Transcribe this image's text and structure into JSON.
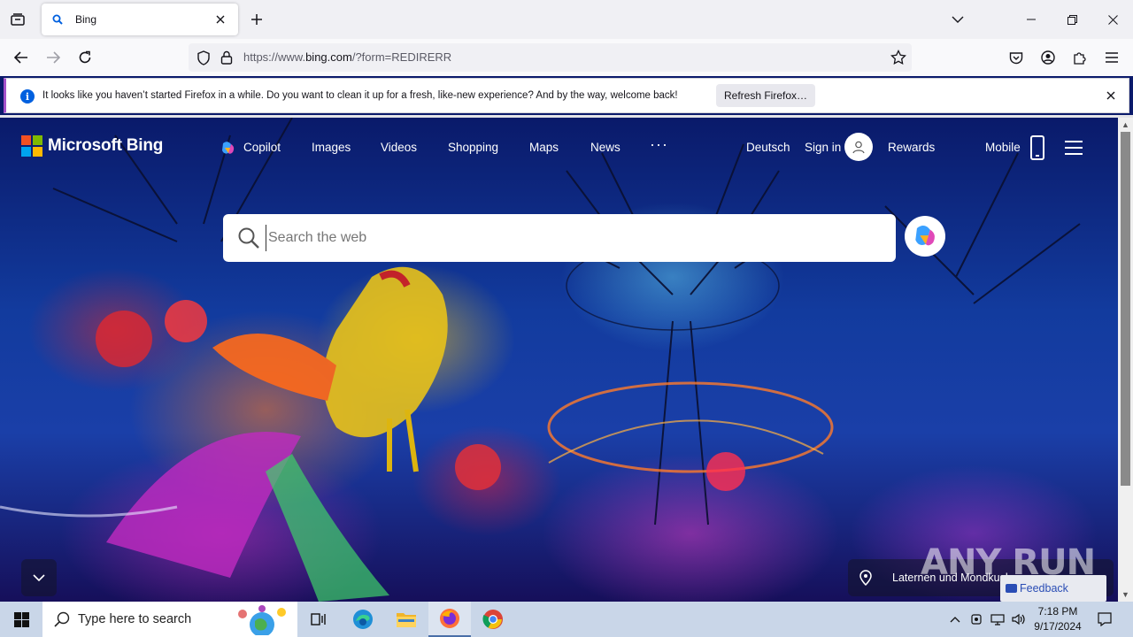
{
  "browser": {
    "tab_title": "Bing",
    "url_prefix": "https://www.",
    "url_domain": "bing.com",
    "url_path": "/?form=REDIRERR"
  },
  "notification": {
    "message": "It looks like you haven’t started Firefox in a while. Do you want to clean it up for a fresh, like-new experience? And by the way, welcome back!",
    "button_label": "Refresh Firefox…"
  },
  "bing": {
    "logo_text": "Microsoft Bing",
    "nav": [
      "Copilot",
      "Images",
      "Videos",
      "Shopping",
      "Maps",
      "News"
    ],
    "more": "···",
    "language": "Deutsch",
    "sign_in": "Sign in",
    "rewards": "Rewards",
    "mobile": "Mobile",
    "search_placeholder": "Search the web",
    "location_text": "Laternen und Mondkuchen",
    "feedback": "Feedback",
    "watermark": "ANY RUN"
  },
  "taskbar": {
    "search_label": "Type here to search",
    "time": "7:18 PM",
    "date": "9/17/2024"
  },
  "colors": {
    "accent_firefox": "#a451c9",
    "info_blue": "#0060df",
    "ms_red": "#f25022",
    "ms_green": "#7fba00",
    "ms_blue": "#00a4ef",
    "ms_yellow": "#ffb900"
  }
}
